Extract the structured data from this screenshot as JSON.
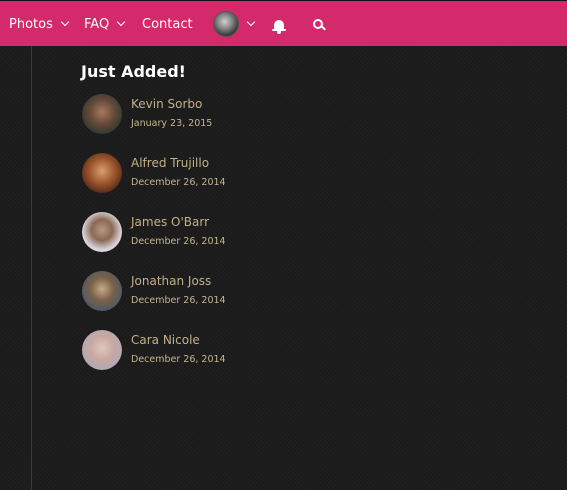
{
  "nav": {
    "photos_label": "Photos",
    "faq_label": "FAQ",
    "contact_label": "Contact"
  },
  "colors": {
    "navbar": "#d42a6b",
    "background": "#1c1c1c",
    "name_text": "#c2b088"
  },
  "section": {
    "title": "Just Added!"
  },
  "entries": [
    {
      "name": "Kevin Sorbo",
      "date": "January 23, 2015"
    },
    {
      "name": "Alfred Trujillo",
      "date": "December 26, 2014"
    },
    {
      "name": "James O'Barr",
      "date": "December 26, 2014"
    },
    {
      "name": "Jonathan Joss",
      "date": "December 26, 2014"
    },
    {
      "name": "Cara Nicole",
      "date": "December 26, 2014"
    }
  ]
}
